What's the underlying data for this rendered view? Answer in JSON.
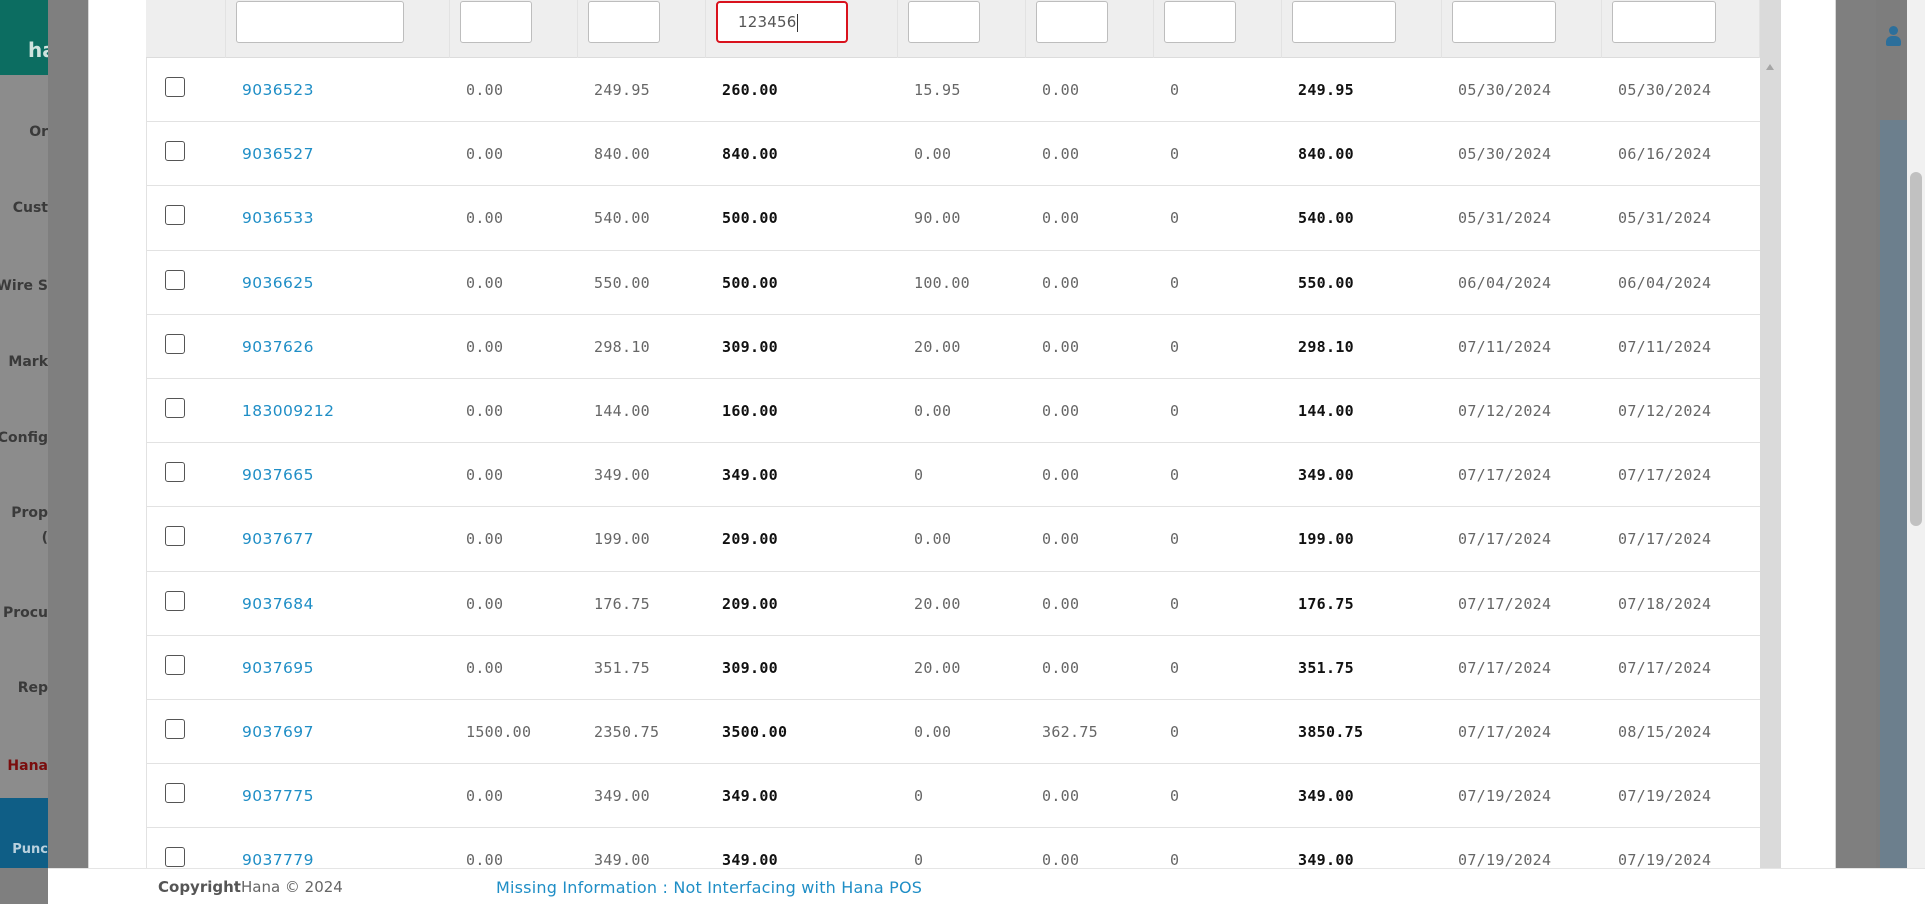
{
  "background": {
    "logo_text": "ha",
    "nav_items": [
      "Or",
      "Cust",
      "Wire S",
      "Mark",
      "Config",
      "Prop",
      "(",
      "Procu",
      "Rep",
      "Hana"
    ],
    "punch_label": "Punc"
  },
  "filters": {
    "values": [
      "",
      "",
      "",
      "123456",
      "",
      "",
      "",
      "",
      "",
      ""
    ]
  },
  "rows": [
    {
      "id": "9036523",
      "c1": "0.00",
      "c2": "249.95",
      "c3": "260.00",
      "c4": "15.95",
      "c5": "0.00",
      "c6": "0",
      "c7": "249.95",
      "d1": "05/30/2024",
      "d2": "05/30/2024"
    },
    {
      "id": "9036527",
      "c1": "0.00",
      "c2": "840.00",
      "c3": "840.00",
      "c4": "0.00",
      "c5": "0.00",
      "c6": "0",
      "c7": "840.00",
      "d1": "05/30/2024",
      "d2": "06/16/2024"
    },
    {
      "id": "9036533",
      "c1": "0.00",
      "c2": "540.00",
      "c3": "500.00",
      "c4": "90.00",
      "c5": "0.00",
      "c6": "0",
      "c7": "540.00",
      "d1": "05/31/2024",
      "d2": "05/31/2024"
    },
    {
      "id": "9036625",
      "c1": "0.00",
      "c2": "550.00",
      "c3": "500.00",
      "c4": "100.00",
      "c5": "0.00",
      "c6": "0",
      "c7": "550.00",
      "d1": "06/04/2024",
      "d2": "06/04/2024"
    },
    {
      "id": "9037626",
      "c1": "0.00",
      "c2": "298.10",
      "c3": "309.00",
      "c4": "20.00",
      "c5": "0.00",
      "c6": "0",
      "c7": "298.10",
      "d1": "07/11/2024",
      "d2": "07/11/2024"
    },
    {
      "id": "183009212",
      "c1": "0.00",
      "c2": "144.00",
      "c3": "160.00",
      "c4": "0.00",
      "c5": "0.00",
      "c6": "0",
      "c7": "144.00",
      "d1": "07/12/2024",
      "d2": "07/12/2024"
    },
    {
      "id": "9037665",
      "c1": "0.00",
      "c2": "349.00",
      "c3": "349.00",
      "c4": "0",
      "c5": "0.00",
      "c6": "0",
      "c7": "349.00",
      "d1": "07/17/2024",
      "d2": "07/17/2024"
    },
    {
      "id": "9037677",
      "c1": "0.00",
      "c2": "199.00",
      "c3": "209.00",
      "c4": "0.00",
      "c5": "0.00",
      "c6": "0",
      "c7": "199.00",
      "d1": "07/17/2024",
      "d2": "07/17/2024"
    },
    {
      "id": "9037684",
      "c1": "0.00",
      "c2": "176.75",
      "c3": "209.00",
      "c4": "20.00",
      "c5": "0.00",
      "c6": "0",
      "c7": "176.75",
      "d1": "07/17/2024",
      "d2": "07/18/2024"
    },
    {
      "id": "9037695",
      "c1": "0.00",
      "c2": "351.75",
      "c3": "309.00",
      "c4": "20.00",
      "c5": "0.00",
      "c6": "0",
      "c7": "351.75",
      "d1": "07/17/2024",
      "d2": "07/17/2024"
    },
    {
      "id": "9037697",
      "c1": "1500.00",
      "c2": "2350.75",
      "c3": "3500.00",
      "c4": "0.00",
      "c5": "362.75",
      "c6": "0",
      "c7": "3850.75",
      "d1": "07/17/2024",
      "d2": "08/15/2024"
    },
    {
      "id": "9037775",
      "c1": "0.00",
      "c2": "349.00",
      "c3": "349.00",
      "c4": "0",
      "c5": "0.00",
      "c6": "0",
      "c7": "349.00",
      "d1": "07/19/2024",
      "d2": "07/19/2024"
    },
    {
      "id": "9037779",
      "c1": "0.00",
      "c2": "349.00",
      "c3": "349.00",
      "c4": "0",
      "c5": "0.00",
      "c6": "0",
      "c7": "349.00",
      "d1": "07/19/2024",
      "d2": "07/19/2024"
    }
  ],
  "footer": {
    "copyright_label": "Copyright",
    "copyright_text": "Hana © 2024",
    "message": "Missing Information : Not Interfacing with Hana POS"
  },
  "colors": {
    "link": "#1f8ec6",
    "active_border": "#d9121d",
    "logo_bg": "#0c6d61",
    "punch_bg": "#0f5e86"
  }
}
